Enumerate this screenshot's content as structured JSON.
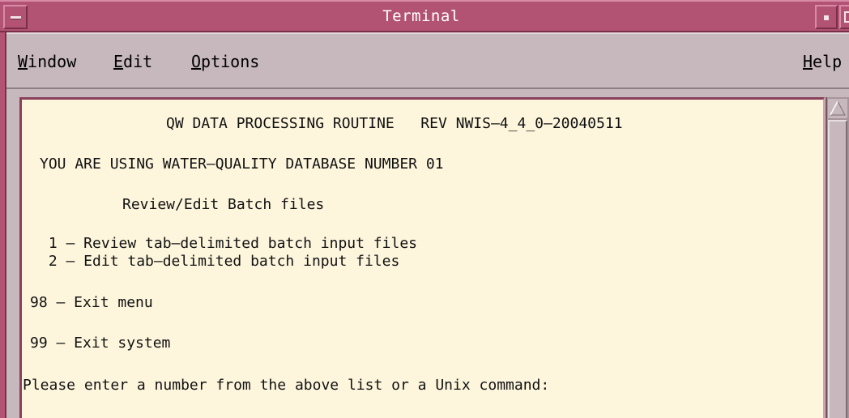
{
  "window": {
    "title": "Terminal"
  },
  "menubar": {
    "items": [
      {
        "mnemonic": "W",
        "rest": "indow"
      },
      {
        "mnemonic": "E",
        "rest": "dit"
      },
      {
        "mnemonic": "O",
        "rest": "ptions"
      }
    ],
    "help": {
      "prefix": "",
      "mnemonic": "H",
      "rest": "elp"
    }
  },
  "terminal": {
    "header": "QW DATA PROCESSING ROUTINE   REV NWIS—4_4_0—20040511",
    "database_notice": "YOU ARE USING WATER—QUALITY DATABASE NUMBER 01",
    "menu_title": "Review/Edit Batch files",
    "options": [
      " 1 — Review tab—delimited batch input files",
      " 2 — Edit tab—delimited batch input files"
    ],
    "exit_menu": "98 — Exit menu",
    "exit_system": "99 — Exit system",
    "prompt": "Please enter a number from the above list or a Unix command:"
  },
  "colors": {
    "titlebar": "#b35374",
    "terminal_background": "#fdf6dd",
    "chrome": "#c6b8bd"
  },
  "icons": {
    "window_menu": "window-menu-icon",
    "minimize": "minimize-icon",
    "maximize": "maximize-icon",
    "scroll_up": "scroll-up-arrow-icon"
  }
}
